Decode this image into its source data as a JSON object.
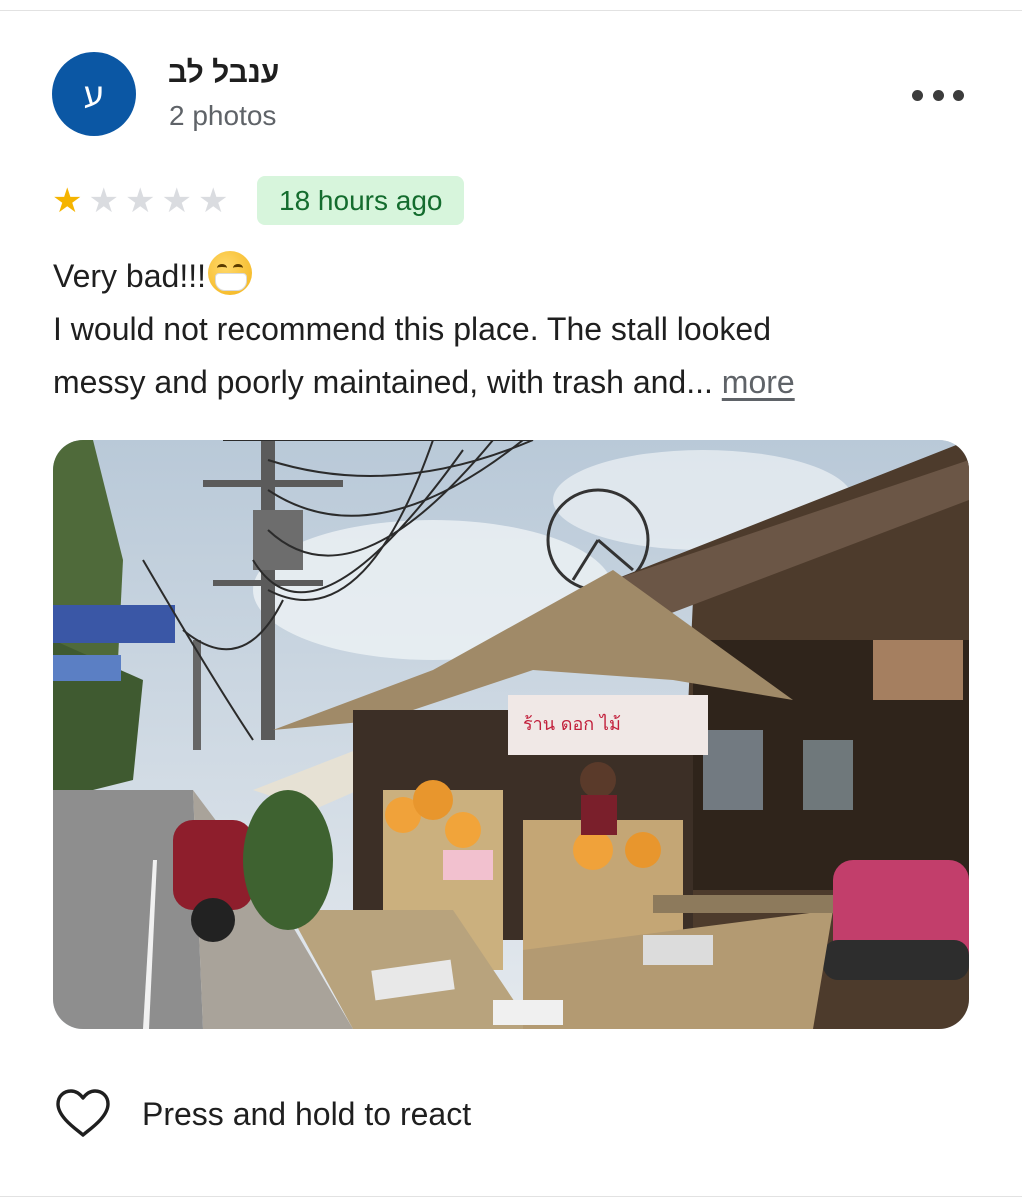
{
  "reviewer": {
    "avatar_initial": "ע",
    "name": "ענבל לב",
    "meta": "2 photos",
    "avatar_color": "#0b57a4"
  },
  "menu": {
    "icon": "more-vertical-dots-icon"
  },
  "review": {
    "rating": 1,
    "max_rating": 5,
    "time_ago": "18 hours ago",
    "headline": "Very bad!!!",
    "headline_emoji": "face-with-medical-mask",
    "body_line_1": "I would not recommend this place. The stall looked",
    "body_line_2": "messy and poorly maintained, with trash and...",
    "more_label": "more"
  },
  "photo": {
    "sign_text": "ร้าน ดอก ไม้"
  },
  "react": {
    "icon": "heart-outline-icon",
    "label": "Press and hold to react"
  },
  "colors": {
    "star_filled": "#f5b400",
    "star_empty": "#dadce0",
    "badge_bg": "#d7f5dc",
    "badge_text": "#146c2e",
    "secondary_text": "#5f6368"
  }
}
